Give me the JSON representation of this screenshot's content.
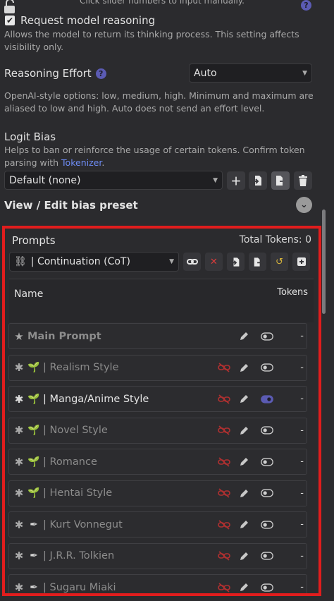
{
  "top": {
    "slider_hint": "Click slider numbers to input manually.",
    "request_reasoning_label": "Request model reasoning",
    "request_reasoning_checked": true,
    "request_reasoning_desc_1": "Allows the model to return its thinking process. This setting affects",
    "request_reasoning_desc_2": "visibility only.",
    "reasoning_effort_label": "Reasoning Effort",
    "reasoning_effort_value": "Auto",
    "reasoning_effort_desc_1": "OpenAI-style options: low, medium, high. Minimum and maximum are",
    "reasoning_effort_desc_2": "aliased to low and high. Auto does not send an effort level.",
    "logit_bias_label": "Logit Bias",
    "logit_bias_desc_1": "Helps to ban or reinforce the usage of certain tokens. Confirm token",
    "logit_bias_desc_2_pre": "parsing with ",
    "logit_bias_link": "Tokenizer",
    "logit_bias_desc_2_post": ".",
    "bias_preset_value": "Default (none)",
    "view_edit_label": "View / Edit bias preset"
  },
  "prompts": {
    "title": "Prompts",
    "total_tokens": "Total Tokens: 0",
    "preset_icon": "⛓",
    "preset_value": "| Continuation (CoT)",
    "col_name": "Name",
    "col_tokens": "Tokens",
    "items": [
      {
        "lead": "★",
        "emoji": "",
        "label": "Main Prompt",
        "tokens": "-",
        "enabled": false,
        "bold": true,
        "unlink": false
      },
      {
        "lead": "✱",
        "emoji": "🌱",
        "label": "| Realism Style",
        "tokens": "-",
        "enabled": false,
        "bold": false,
        "unlink": true
      },
      {
        "lead": "✱",
        "emoji": "🌱",
        "label": "| Manga/Anime Style",
        "tokens": "-",
        "enabled": true,
        "bold": false,
        "unlink": true
      },
      {
        "lead": "✱",
        "emoji": "🌱",
        "label": "| Novel Style",
        "tokens": "-",
        "enabled": false,
        "bold": false,
        "unlink": true
      },
      {
        "lead": "✱",
        "emoji": "🌱",
        "label": "| Romance",
        "tokens": "-",
        "enabled": false,
        "bold": false,
        "unlink": true
      },
      {
        "lead": "✱",
        "emoji": "🌱",
        "label": "| Hentai Style",
        "tokens": "-",
        "enabled": false,
        "bold": false,
        "unlink": true
      },
      {
        "lead": "✱",
        "emoji": "✒",
        "label": "| Kurt Vonnegut",
        "tokens": "-",
        "enabled": false,
        "bold": false,
        "unlink": true
      },
      {
        "lead": "✱",
        "emoji": "✒",
        "label": "| J.R.R. Tolkien",
        "tokens": "-",
        "enabled": false,
        "bold": false,
        "unlink": true
      },
      {
        "lead": "✱",
        "emoji": "✒",
        "label": "| Sugaru Miaki",
        "tokens": "-",
        "enabled": false,
        "bold": false,
        "unlink": true
      }
    ]
  },
  "colors": {
    "accent": "#5b5bb3",
    "highlight_border": "#e11d1d",
    "link": "#6e8cf5",
    "unlink_icon": "#b03030"
  }
}
